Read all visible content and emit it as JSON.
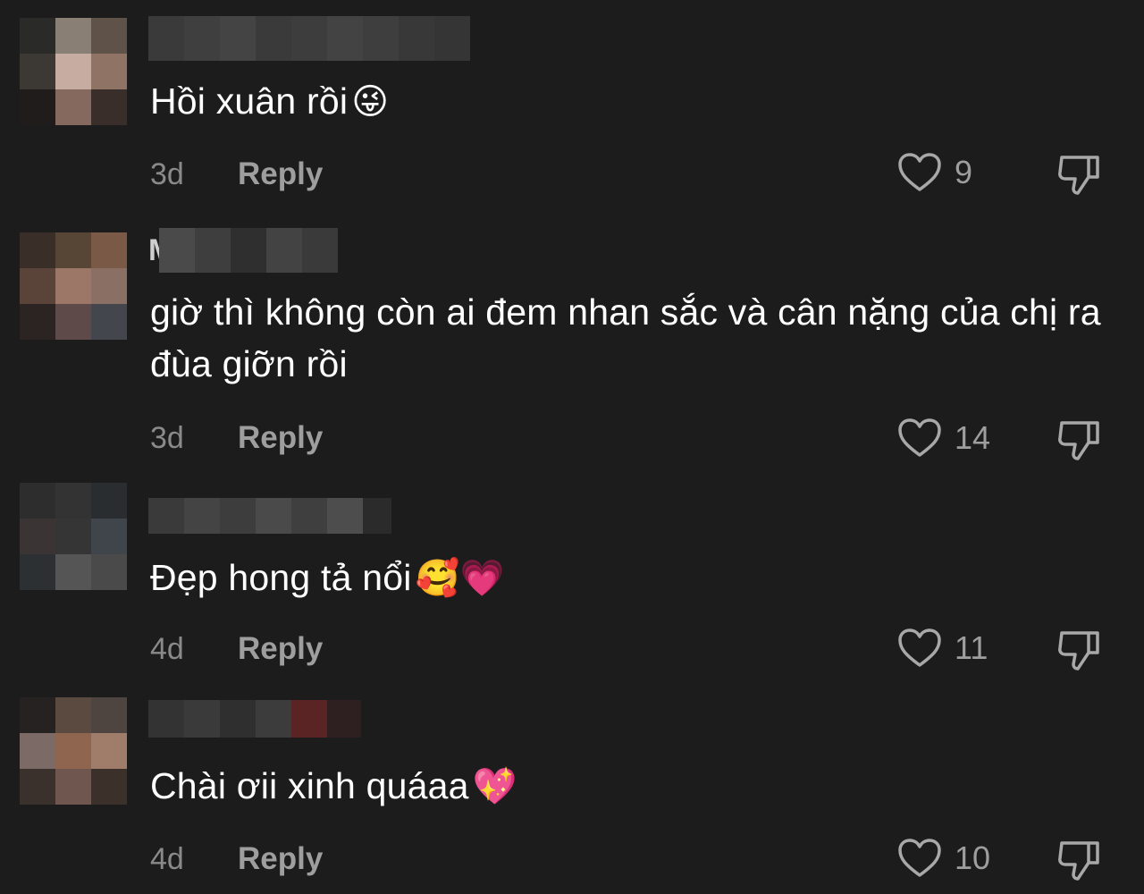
{
  "comments": [
    {
      "text": "Hồi xuân rồi",
      "emoji": "😜",
      "time": "3d",
      "reply_label": "Reply",
      "likes": "9",
      "username_initial": ""
    },
    {
      "text": "giờ thì không còn ai đem nhan sắc và cân nặng của chị ra đùa giỡn rồi",
      "emoji": "",
      "time": "3d",
      "reply_label": "Reply",
      "likes": "14",
      "username_initial": "M"
    },
    {
      "text": "Đẹp hong tả nổi",
      "emoji": "🥰💗",
      "time": "4d",
      "reply_label": "Reply",
      "likes": "11",
      "username_initial": ""
    },
    {
      "text": "Chài ơii xinh quáaa",
      "emoji": "💖",
      "time": "4d",
      "reply_label": "Reply",
      "likes": "10",
      "username_initial": ""
    }
  ],
  "colors": {
    "background": "#1c1c1c",
    "text": "#ffffff",
    "muted": "#8a8a8a",
    "action": "#9e9e9e"
  },
  "icons": {
    "like": "heart-outline-icon",
    "dislike": "thumbs-down-outline-icon"
  }
}
